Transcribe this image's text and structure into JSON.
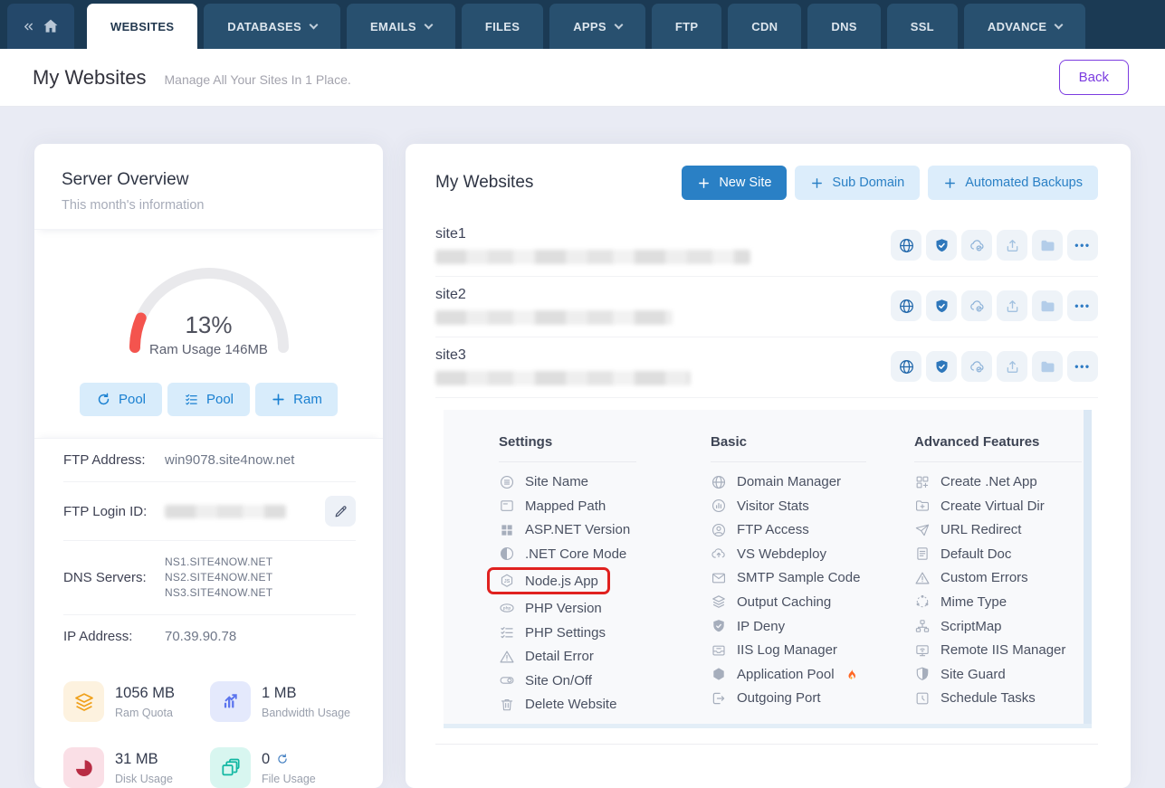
{
  "nav": {
    "home_icon": "home-icon",
    "collapse_icon": "double-chevron-left-icon",
    "tabs": [
      {
        "label": "WEBSITES",
        "active": true,
        "dropdown": false
      },
      {
        "label": "DATABASES",
        "active": false,
        "dropdown": true
      },
      {
        "label": "EMAILS",
        "active": false,
        "dropdown": true
      },
      {
        "label": "FILES",
        "active": false,
        "dropdown": false
      },
      {
        "label": "APPS",
        "active": false,
        "dropdown": true
      },
      {
        "label": "FTP",
        "active": false,
        "dropdown": false
      },
      {
        "label": "CDN",
        "active": false,
        "dropdown": false
      },
      {
        "label": "DNS",
        "active": false,
        "dropdown": false
      },
      {
        "label": "SSL",
        "active": false,
        "dropdown": false
      },
      {
        "label": "ADVANCE",
        "active": false,
        "dropdown": true
      }
    ]
  },
  "header": {
    "title": "My Websites",
    "subtitle": "Manage All Your Sites In 1 Place.",
    "back_label": "Back"
  },
  "server_overview": {
    "title": "Server Overview",
    "subtitle": "This month's information",
    "gauge": {
      "percent": 13,
      "value_text": "13%",
      "label": "Ram Usage 146MB",
      "color": "#f4544e"
    },
    "buttons": [
      {
        "label": "Pool",
        "icon": "refresh-icon"
      },
      {
        "label": "Pool",
        "icon": "checklist-icon"
      },
      {
        "label": "Ram",
        "icon": "plus-icon"
      }
    ],
    "details": {
      "ftp_address": {
        "label": "FTP Address:",
        "value": "win9078.site4now.net"
      },
      "ftp_login": {
        "label": "FTP Login ID:",
        "value_redacted": true,
        "edit_icon": "pencil-icon"
      },
      "dns": {
        "label": "DNS Servers:",
        "values": [
          "NS1.SITE4NOW.NET",
          "NS2.SITE4NOW.NET",
          "NS3.SITE4NOW.NET"
        ]
      },
      "ip": {
        "label": "IP Address:",
        "value": "70.39.90.78"
      }
    },
    "stats": [
      {
        "value": "1056 MB",
        "label": "Ram Quota",
        "icon": "layers-icon",
        "color": "#f0a11c"
      },
      {
        "value": "1 MB",
        "label": "Bandwidth Usage",
        "icon": "bar-chart-icon",
        "color": "#5b74ee"
      },
      {
        "value": "31 MB",
        "label": "Disk Usage",
        "icon": "pie-chart-icon",
        "color": "#b82c44"
      },
      {
        "value": "0",
        "label": "File Usage",
        "icon": "copies-icon",
        "refresh_icon": "refresh-icon",
        "color": "#11b7a2"
      }
    ]
  },
  "websites_panel": {
    "title": "My Websites",
    "actions": [
      {
        "label": "New Site",
        "icon": "plus-icon",
        "primary": true
      },
      {
        "label": "Sub Domain",
        "icon": "plus-icon",
        "primary": false
      },
      {
        "label": "Automated Backups",
        "icon": "plus-icon",
        "primary": false
      }
    ],
    "sites": [
      {
        "name": "site1",
        "url_redacted": true
      },
      {
        "name": "site2",
        "url_redacted": true
      },
      {
        "name": "site3",
        "url_redacted": true
      }
    ],
    "row_action_icons": [
      "globe-icon",
      "shield-check-icon",
      "cloud-check-icon",
      "upload-icon",
      "folder-icon",
      "ellipsis-icon"
    ]
  },
  "menu": {
    "columns": [
      {
        "title": "Settings",
        "items": [
          {
            "label": "Site Name",
            "icon": "list-circle-icon"
          },
          {
            "label": "Mapped Path",
            "icon": "doc-tab-icon"
          },
          {
            "label": "ASP.NET Version",
            "icon": "grid-icon"
          },
          {
            "label": ".NET Core Mode",
            "icon": "contrast-icon"
          },
          {
            "label": "Node.js App",
            "icon": "nodejs-icon",
            "highlighted": true,
            "highlight_color": "#e0211f"
          },
          {
            "label": "PHP Version",
            "icon": "php-icon"
          },
          {
            "label": "PHP Settings",
            "icon": "checklist-icon"
          },
          {
            "label": "Detail Error",
            "icon": "warning-icon"
          },
          {
            "label": "Site On/Off",
            "icon": "toggle-icon"
          },
          {
            "label": "Delete Website",
            "icon": "trash-icon"
          }
        ]
      },
      {
        "title": "Basic",
        "items": [
          {
            "label": "Domain Manager",
            "icon": "globe-icon"
          },
          {
            "label": "Visitor Stats",
            "icon": "stats-circle-icon"
          },
          {
            "label": "FTP Access",
            "icon": "user-circle-icon"
          },
          {
            "label": "VS Webdeploy",
            "icon": "cloud-up-icon"
          },
          {
            "label": "SMTP Sample Code",
            "icon": "envelope-icon"
          },
          {
            "label": "Output Caching",
            "icon": "layers-icon"
          },
          {
            "label": "IP Deny",
            "icon": "shield-solid-icon"
          },
          {
            "label": "IIS Log Manager",
            "icon": "inbox-icon"
          },
          {
            "label": "Application Pool",
            "icon": "hexagon-icon",
            "badge_icon": "fire-icon"
          },
          {
            "label": "Outgoing Port",
            "icon": "box-arrow-icon"
          }
        ]
      },
      {
        "title": "Advanced Features",
        "items": [
          {
            "label": "Create .Net App",
            "icon": "grid-plus-icon"
          },
          {
            "label": "Create Virtual Dir",
            "icon": "folder-plus-icon"
          },
          {
            "label": "URL Redirect",
            "icon": "paper-plane-icon"
          },
          {
            "label": "Default Doc",
            "icon": "doc-lines-icon"
          },
          {
            "label": "Custom Errors",
            "icon": "warning-icon"
          },
          {
            "label": "Mime Type",
            "icon": "share-nodes-icon"
          },
          {
            "label": "ScriptMap",
            "icon": "sitemap-icon"
          },
          {
            "label": "Remote IIS Manager",
            "icon": "monitor-icon"
          },
          {
            "label": "Site Guard",
            "icon": "shield-half-icon"
          },
          {
            "label": "Schedule Tasks",
            "icon": "clock-icon"
          }
        ]
      }
    ]
  },
  "colors": {
    "nav_bg": "#1b3a54",
    "tab_bg": "#28506f",
    "accent_blue": "#2a80c5",
    "light_blue_bg": "#dcedfb",
    "purple": "#7b3be0",
    "gauge_red": "#f4544e",
    "highlight_red": "#e0211f",
    "page_bg": "#e9ebf4"
  }
}
